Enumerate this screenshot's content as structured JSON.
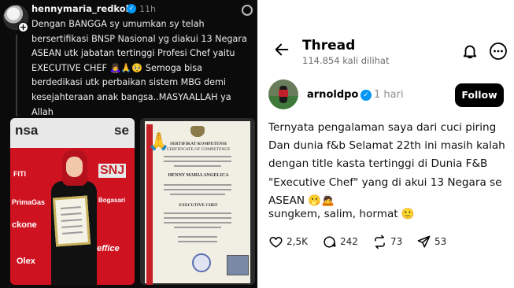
{
  "left_post": {
    "username": "hennymaria_redkoki",
    "time": "11h",
    "body": "Dengan BANGGA sy umumkan sy telah\nbersertifikasi BNSP Nasional yg diakui 13 Negara\nASEAN utk jabatan tertinggi Profesi Chef yaitu\nEXECUTIVE CHEF 🙇‍♀️🙏🥺 Semoga bisa\nberdedikasi utk perbaikan sistem MBG demi\nkesejahteraan anak bangsa..MASYAALLAH ya Allah\n🥹😭",
    "photo1_signs": [
      "nsa",
      "se",
      "SNJ",
      "Bogasari",
      "FITI",
      "PrimaGas",
      "ckone",
      "Jeffice",
      "Olex"
    ],
    "certificate": {
      "header": "SERTIFIKAT KOMPETENSI",
      "subheader": "CERTIFICATE OF COMPETENCE",
      "name": "HENNY MARIA ANGELICA",
      "position": "EXECUTIVE CHEF"
    }
  },
  "right_post": {
    "header_title": "Thread",
    "views": "114.854 kali dilihat",
    "username": "arnoldpo",
    "time": "1 hari",
    "follow_label": "Follow",
    "body": "Ternyata pengalaman saya dari cuci piring\nDan dunia f&b Selamat 22th ini masih kalah\ndengan title kasta tertinggi di Dunia F&B\n\"Executive Chef\" yang di akui 13 Negara se\nASEAN 🫢🙇",
    "reply_line": "sungkem, salim, hormat 🙂",
    "actions": {
      "likes": "2,5K",
      "comments": "242",
      "reposts": "73",
      "shares": "53"
    }
  },
  "icons": {
    "back": "arrow-left-icon",
    "bell": "bell-icon",
    "more": "more-icon",
    "like": "heart-icon",
    "comment": "comment-icon",
    "repost": "repost-icon",
    "share": "share-icon"
  },
  "colors": {
    "verified": "#0095f6",
    "follow_bg": "#000000",
    "left_bg": "#0b0b0b",
    "banner_red": "#cf1220"
  }
}
